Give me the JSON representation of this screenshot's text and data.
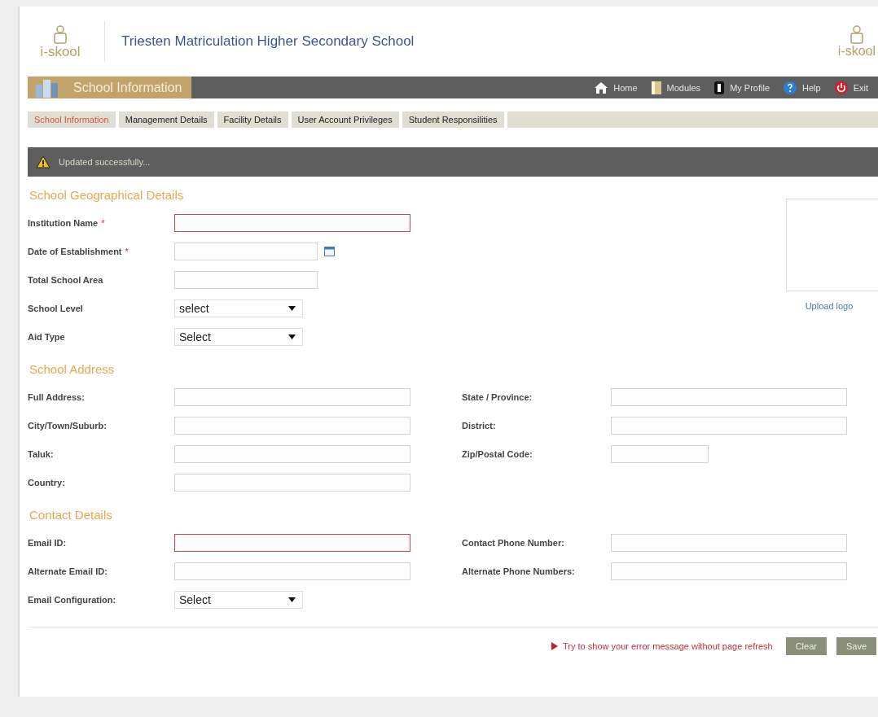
{
  "header": {
    "logo_text": "i-skool",
    "title": "Triesten Matriculation Higher Secondary School",
    "logo_text_right": "i-skool"
  },
  "module_bar": {
    "title": "School Information",
    "nav": [
      {
        "label": "Home"
      },
      {
        "label": "Modules"
      },
      {
        "label": "My Profile"
      },
      {
        "label": "Help"
      },
      {
        "label": "Exit"
      }
    ]
  },
  "tabs": [
    {
      "label": "School Information",
      "selected": true
    },
    {
      "label": "Management Details",
      "selected": false
    },
    {
      "label": "Facility Details",
      "selected": false
    },
    {
      "label": "User Account Privileges",
      "selected": false
    },
    {
      "label": "Student Responsilities",
      "selected": false
    }
  ],
  "alert": {
    "text": "Updated successfully..."
  },
  "geo_section": {
    "title": "School Geographical Details",
    "fields": [
      {
        "label": "Institution Name",
        "mark": "*",
        "kind": "text",
        "invalid": true
      },
      {
        "label": "Date of Establishment",
        "mark": "*",
        "kind": "date",
        "invalid": false
      },
      {
        "label": "Total School Area",
        "kind": "short",
        "invalid": false
      },
      {
        "label": "School Level",
        "kind": "select",
        "value": "select"
      },
      {
        "label": "Aid Type",
        "kind": "select",
        "value": "Select"
      }
    ],
    "logo_link": "Upload logo"
  },
  "sections": [
    {
      "title": "School Address",
      "left": [
        {
          "label": "Full Address:",
          "kind": "text",
          "invalid": false
        },
        {
          "label": "City/Town/Suburb:",
          "kind": "text",
          "invalid": false
        },
        {
          "label": "Taluk:",
          "kind": "text",
          "invalid": false
        },
        {
          "label": "Country:",
          "kind": "text",
          "invalid": false
        }
      ],
      "right": [
        {
          "label": "State / Province:",
          "kind": "text",
          "invalid": false
        },
        {
          "label": "District:",
          "kind": "text",
          "invalid": false
        },
        {
          "label": "Zip/Postal Code:",
          "kind": "zip",
          "invalid": false
        }
      ]
    },
    {
      "title": "Contact Details",
      "left": [
        {
          "label": "Email ID:",
          "kind": "text",
          "invalid": true
        },
        {
          "label": "Alternate Email ID:",
          "kind": "text",
          "invalid": false
        },
        {
          "label": "Email Configuration:",
          "kind": "select",
          "value": "Select"
        }
      ],
      "right": [
        {
          "label": "Contact Phone Number:",
          "kind": "text",
          "invalid": false
        },
        {
          "label": "Alternate Phone Numbers:",
          "kind": "text",
          "invalid": false
        }
      ]
    }
  ],
  "footer": {
    "message": "Try to show your error message without page refresh",
    "buttons": [
      "Clear",
      "Save"
    ]
  }
}
